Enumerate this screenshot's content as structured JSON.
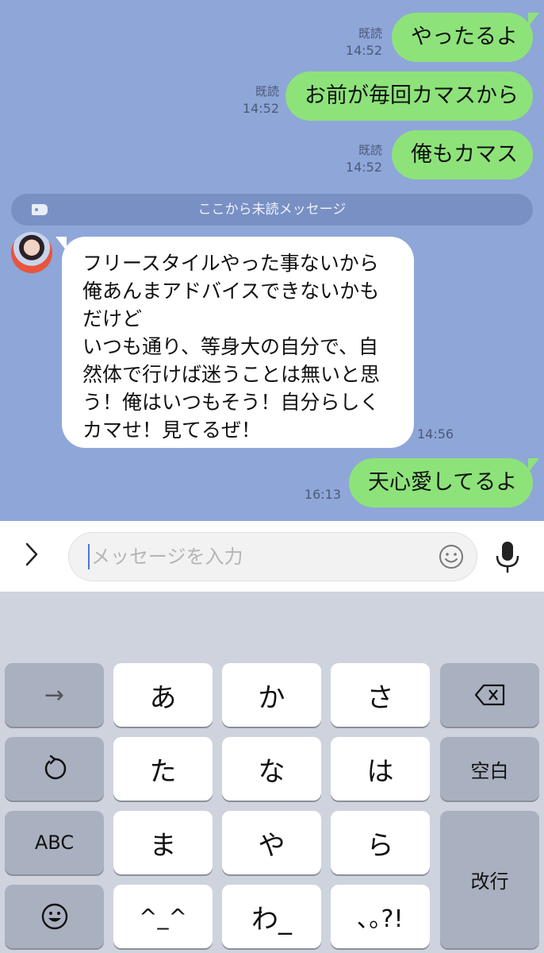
{
  "messages": {
    "sent": [
      {
        "text": "やったるよ",
        "read": "既読",
        "time": "14:52"
      },
      {
        "text": "お前が毎回カマスから",
        "read": "既読",
        "time": "14:52"
      },
      {
        "text": "俺もカマス",
        "read": "既読",
        "time": "14:52"
      }
    ],
    "unread_divider": "ここから未読メッセージ",
    "received": {
      "lines": [
        "フリースタイルやった事ないから",
        "俺あんまアドバイスできないかも",
        "だけど",
        "いつも通り、等身大の自分で、自",
        "然体で行けば迷うことは無いと思",
        "う！俺はいつもそう！自分らしく",
        "カマせ！見てるぜ！"
      ],
      "time": "14:56"
    },
    "last_sent": {
      "text": "天心愛してるよ",
      "time": "16:13"
    }
  },
  "input": {
    "placeholder": "メッセージを入力"
  },
  "keyboard": {
    "arrow": "→",
    "kana": [
      "あ",
      "か",
      "さ",
      "た",
      "な",
      "は",
      "ま",
      "や",
      "ら",
      "^_^",
      "わ_",
      "､｡?!"
    ],
    "space": "空白",
    "abc": "ABC",
    "enter": "改行"
  },
  "colors": {
    "chat_bg": "#8fa6d8",
    "sent_bubble": "#8de37a",
    "received_bubble": "#ffffff",
    "keyboard_bg": "#cfd3de"
  }
}
